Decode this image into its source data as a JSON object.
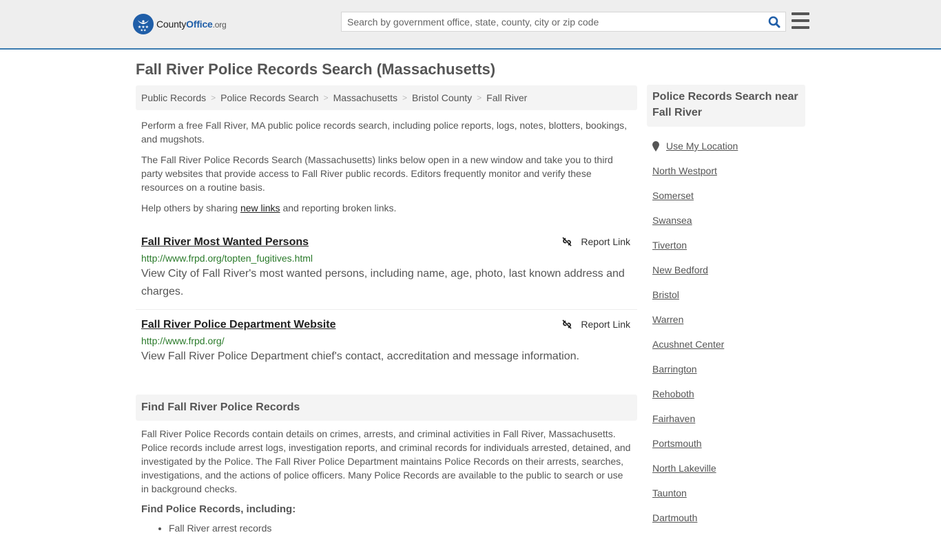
{
  "header": {
    "logo": {
      "county": "County",
      "office": "Office",
      "tld": ".org"
    },
    "search": {
      "placeholder": "Search by government office, state, county, city or zip code",
      "value": ""
    },
    "colors": {
      "brand": "#1f5ea8",
      "header_border": "#3b7bb0"
    }
  },
  "page": {
    "title": "Fall River Police Records Search (Massachusetts)"
  },
  "breadcrumb": [
    {
      "label": "Public Records"
    },
    {
      "label": "Police Records Search"
    },
    {
      "label": "Massachusetts"
    },
    {
      "label": "Bristol County"
    },
    {
      "label": "Fall River"
    }
  ],
  "intro": {
    "p1": "Perform a free Fall River, MA public police records search, including police reports, logs, notes, blotters, bookings, and mugshots.",
    "p2": "The Fall River Police Records Search (Massachusetts) links below open in a new window and take you to third party websites that provide access to Fall River public records. Editors frequently monitor and verify these resources on a routine basis.",
    "p3_before": "Help others by sharing ",
    "p3_link": "new links",
    "p3_after": " and reporting broken links."
  },
  "listings": [
    {
      "title": "Fall River Most Wanted Persons",
      "url": "http://www.frpd.org/topten_fugitives.html",
      "description": "View City of Fall River's most wanted persons, including name, age, photo, last known address and charges.",
      "report_label": "Report Link"
    },
    {
      "title": "Fall River Police Department Website",
      "url": "http://www.frpd.org/",
      "description": "View Fall River Police Department chief's contact, accreditation and message information.",
      "report_label": "Report Link"
    }
  ],
  "find_section": {
    "heading": "Find Fall River Police Records",
    "body": "Fall River Police Records contain details on crimes, arrests, and criminal activities in Fall River, Massachusetts. Police records include arrest logs, investigation reports, and criminal records for individuals arrested, detained, and investigated by the Police. The Fall River Police Department maintains Police Records on their arrests, searches, investigations, and the actions of police officers. Many Police Records are available to the public to search or use in background checks.",
    "subheading": "Find Police Records, including:",
    "items": [
      "Fall River arrest records"
    ]
  },
  "sidebar": {
    "heading": "Police Records Search near Fall River",
    "use_location": "Use My Location",
    "cities": [
      "North Westport",
      "Somerset",
      "Swansea",
      "Tiverton",
      "New Bedford",
      "Bristol",
      "Warren",
      "Acushnet Center",
      "Barrington",
      "Rehoboth",
      "Fairhaven",
      "Portsmouth",
      "North Lakeville",
      "Taunton",
      "Dartmouth"
    ]
  }
}
